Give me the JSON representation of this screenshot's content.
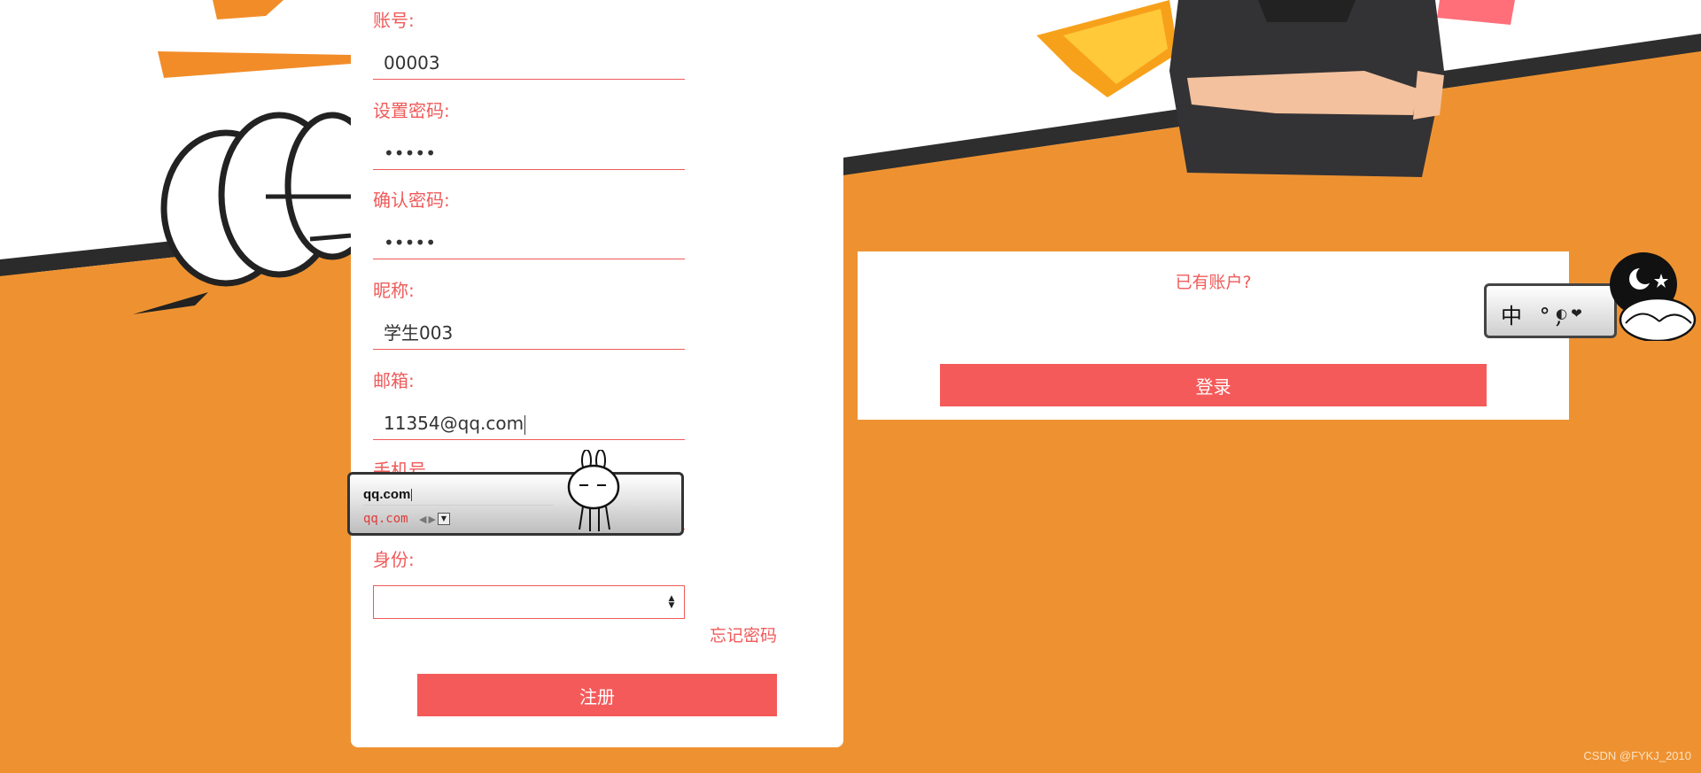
{
  "register_form": {
    "account_label": "账号:",
    "account_value": "00003",
    "password_label": "设置密码:",
    "password_value": "•••••",
    "confirm_label": "确认密码:",
    "confirm_value": "•••••",
    "nickname_label": "昵称:",
    "nickname_value": "学生003",
    "email_label": "邮箱:",
    "email_value": "11354@qq.com",
    "phone_label": "手机号",
    "identity_label": "身份:",
    "identity_value": "",
    "forgot_label": "忘记密码",
    "register_label": "注册"
  },
  "login_panel": {
    "question": "已有账户?",
    "login_label": "登录"
  },
  "ime": {
    "composition": "qq.com",
    "candidate": "qq.com",
    "toolbar_text": "中 °,"
  },
  "watermark": "CSDN @FYKJ_2010",
  "colors": {
    "accent": "#f55a5a",
    "label": "#f05a5a",
    "background": "#ee9231",
    "card": "#ffffff"
  }
}
